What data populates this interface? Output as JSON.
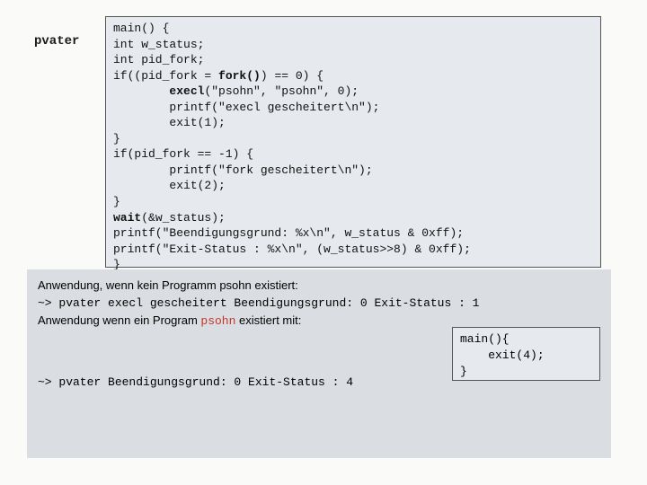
{
  "label": "pvater",
  "code_main": "main() {\nint w_status;\nint pid_fork;\nif((pid_fork = <b>fork()</b>) == 0) {\n        <b>execl</b>(\"psohn\", \"psohn\", 0);\n        printf(\"execl gescheitert\\n\");\n        exit(1);\n}\nif(pid_fork == -1) {\n        printf(\"fork gescheitert\\n\");\n        exit(2);\n}\n<b>wait</b>(&w_status);\nprintf(\"Beendigungsgrund: %x\\n\", w_status & 0xff);\nprintf(\"Exit-Status : %x\\n\", (w_status>>8) & 0xff);\n}",
  "bottom": {
    "line1": "Anwendung, wenn kein Programm psohn existiert:",
    "run1": "~> pvater\nexecl gescheitert Beendigungsgrund: 0\nExit-Status : 1",
    "line2_a": "Anwendung wenn ein Program ",
    "line2_b": "psohn",
    "line2_c": " existiert mit:",
    "run2": "~> pvater\nBeendigungsgrund: 0\nExit-Status : 4"
  },
  "child_code": "main(){\n    exit(4);\n}"
}
